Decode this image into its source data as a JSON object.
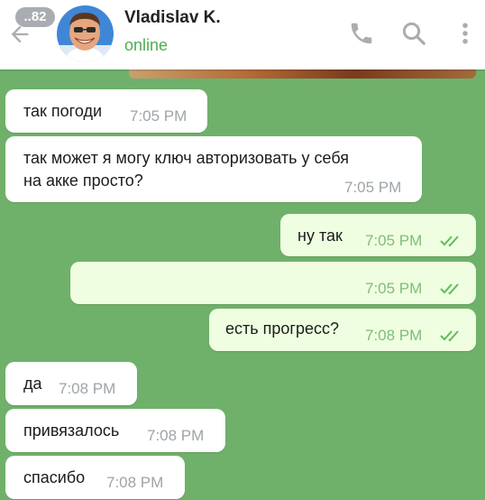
{
  "header": {
    "unread_count": "..82",
    "contact_name": "Vladislav K.",
    "status": "online"
  },
  "icons": {
    "back": "arrow-left-icon",
    "call": "phone-icon",
    "search": "search-icon",
    "menu": "more-vertical-icon",
    "read": "double-check-icon"
  },
  "colors": {
    "chat_background": "#6fb16a",
    "incoming_bubble": "#ffffff",
    "outgoing_bubble": "#effee0",
    "online_status": "#4caf50",
    "read_check": "#5ebd58"
  },
  "messages": [
    {
      "direction": "in",
      "lines": [
        "так погоди"
      ],
      "time": "7:05 PM"
    },
    {
      "direction": "in",
      "lines": [
        "так может я могу ключ авторизовать у себя",
        "на акке просто?"
      ],
      "time": "7:05 PM"
    },
    {
      "direction": "out",
      "lines": [
        "ну так"
      ],
      "time": "7:05 PM",
      "read": true
    },
    {
      "direction": "out",
      "lines": [
        ""
      ],
      "time": "7:05 PM",
      "read": true
    },
    {
      "direction": "out",
      "lines": [
        "есть прогресс?"
      ],
      "time": "7:08 PM",
      "read": true
    },
    {
      "direction": "in",
      "lines": [
        "да"
      ],
      "time": "7:08 PM"
    },
    {
      "direction": "in",
      "lines": [
        "привязалось"
      ],
      "time": "7:08 PM"
    },
    {
      "direction": "in",
      "lines": [
        "спасибо"
      ],
      "time": "7:08 PM"
    }
  ]
}
